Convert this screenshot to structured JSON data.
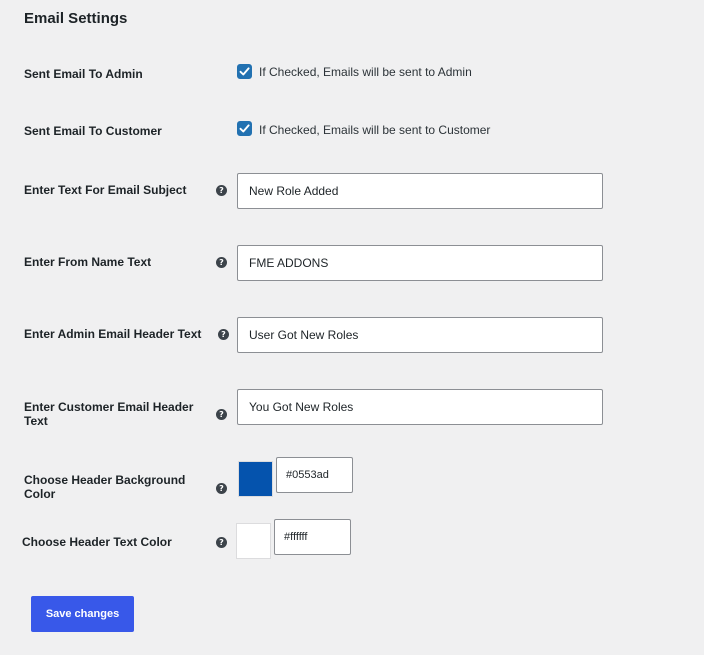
{
  "page": {
    "title": "Email Settings"
  },
  "settings": {
    "send_admin": {
      "label": "Sent Email To Admin",
      "description": "If Checked, Emails will be sent to Admin",
      "checked": true
    },
    "send_customer": {
      "label": "Sent Email To Customer",
      "description": "If Checked, Emails will be sent to Customer",
      "checked": true
    },
    "email_subject": {
      "label": "Enter Text For Email Subject",
      "value": "New Role Added"
    },
    "from_name": {
      "label": "Enter From Name Text",
      "value": "FME ADDONS"
    },
    "admin_header": {
      "label": "Enter Admin Email Header Text",
      "value": "User Got New Roles"
    },
    "customer_header": {
      "label_line1": "Enter Customer Email Header",
      "label_line2": "Text",
      "value": "You Got New Roles"
    },
    "header_bg_color": {
      "label_line1": "Choose Header Background",
      "label_line2": "Color",
      "value": "#0553ad",
      "swatch": "#0553ad"
    },
    "header_text_color": {
      "label": "Choose Header Text Color",
      "value": "#ffffff",
      "swatch": "#ffffff"
    }
  },
  "help_glyph": "?",
  "actions": {
    "save_label": "Save changes"
  },
  "colors": {
    "checkbox": "#2271b1",
    "primary_button": "#3858e9",
    "background": "#f0f0f1"
  }
}
